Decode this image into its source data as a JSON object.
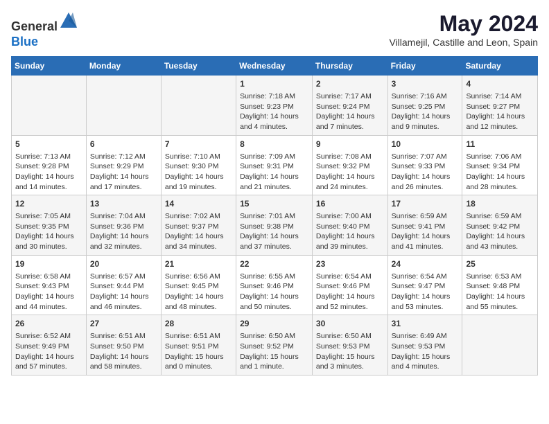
{
  "header": {
    "logo_line1": "General",
    "logo_line2": "Blue",
    "title": "May 2024",
    "subtitle": "Villamejil, Castille and Leon, Spain"
  },
  "weekdays": [
    "Sunday",
    "Monday",
    "Tuesday",
    "Wednesday",
    "Thursday",
    "Friday",
    "Saturday"
  ],
  "weeks": [
    [
      {
        "day": "",
        "info": ""
      },
      {
        "day": "",
        "info": ""
      },
      {
        "day": "",
        "info": ""
      },
      {
        "day": "1",
        "info": "Sunrise: 7:18 AM\nSunset: 9:23 PM\nDaylight: 14 hours and 4 minutes."
      },
      {
        "day": "2",
        "info": "Sunrise: 7:17 AM\nSunset: 9:24 PM\nDaylight: 14 hours and 7 minutes."
      },
      {
        "day": "3",
        "info": "Sunrise: 7:16 AM\nSunset: 9:25 PM\nDaylight: 14 hours and 9 minutes."
      },
      {
        "day": "4",
        "info": "Sunrise: 7:14 AM\nSunset: 9:27 PM\nDaylight: 14 hours and 12 minutes."
      }
    ],
    [
      {
        "day": "5",
        "info": "Sunrise: 7:13 AM\nSunset: 9:28 PM\nDaylight: 14 hours and 14 minutes."
      },
      {
        "day": "6",
        "info": "Sunrise: 7:12 AM\nSunset: 9:29 PM\nDaylight: 14 hours and 17 minutes."
      },
      {
        "day": "7",
        "info": "Sunrise: 7:10 AM\nSunset: 9:30 PM\nDaylight: 14 hours and 19 minutes."
      },
      {
        "day": "8",
        "info": "Sunrise: 7:09 AM\nSunset: 9:31 PM\nDaylight: 14 hours and 21 minutes."
      },
      {
        "day": "9",
        "info": "Sunrise: 7:08 AM\nSunset: 9:32 PM\nDaylight: 14 hours and 24 minutes."
      },
      {
        "day": "10",
        "info": "Sunrise: 7:07 AM\nSunset: 9:33 PM\nDaylight: 14 hours and 26 minutes."
      },
      {
        "day": "11",
        "info": "Sunrise: 7:06 AM\nSunset: 9:34 PM\nDaylight: 14 hours and 28 minutes."
      }
    ],
    [
      {
        "day": "12",
        "info": "Sunrise: 7:05 AM\nSunset: 9:35 PM\nDaylight: 14 hours and 30 minutes."
      },
      {
        "day": "13",
        "info": "Sunrise: 7:04 AM\nSunset: 9:36 PM\nDaylight: 14 hours and 32 minutes."
      },
      {
        "day": "14",
        "info": "Sunrise: 7:02 AM\nSunset: 9:37 PM\nDaylight: 14 hours and 34 minutes."
      },
      {
        "day": "15",
        "info": "Sunrise: 7:01 AM\nSunset: 9:38 PM\nDaylight: 14 hours and 37 minutes."
      },
      {
        "day": "16",
        "info": "Sunrise: 7:00 AM\nSunset: 9:40 PM\nDaylight: 14 hours and 39 minutes."
      },
      {
        "day": "17",
        "info": "Sunrise: 6:59 AM\nSunset: 9:41 PM\nDaylight: 14 hours and 41 minutes."
      },
      {
        "day": "18",
        "info": "Sunrise: 6:59 AM\nSunset: 9:42 PM\nDaylight: 14 hours and 43 minutes."
      }
    ],
    [
      {
        "day": "19",
        "info": "Sunrise: 6:58 AM\nSunset: 9:43 PM\nDaylight: 14 hours and 44 minutes."
      },
      {
        "day": "20",
        "info": "Sunrise: 6:57 AM\nSunset: 9:44 PM\nDaylight: 14 hours and 46 minutes."
      },
      {
        "day": "21",
        "info": "Sunrise: 6:56 AM\nSunset: 9:45 PM\nDaylight: 14 hours and 48 minutes."
      },
      {
        "day": "22",
        "info": "Sunrise: 6:55 AM\nSunset: 9:46 PM\nDaylight: 14 hours and 50 minutes."
      },
      {
        "day": "23",
        "info": "Sunrise: 6:54 AM\nSunset: 9:46 PM\nDaylight: 14 hours and 52 minutes."
      },
      {
        "day": "24",
        "info": "Sunrise: 6:54 AM\nSunset: 9:47 PM\nDaylight: 14 hours and 53 minutes."
      },
      {
        "day": "25",
        "info": "Sunrise: 6:53 AM\nSunset: 9:48 PM\nDaylight: 14 hours and 55 minutes."
      }
    ],
    [
      {
        "day": "26",
        "info": "Sunrise: 6:52 AM\nSunset: 9:49 PM\nDaylight: 14 hours and 57 minutes."
      },
      {
        "day": "27",
        "info": "Sunrise: 6:51 AM\nSunset: 9:50 PM\nDaylight: 14 hours and 58 minutes."
      },
      {
        "day": "28",
        "info": "Sunrise: 6:51 AM\nSunset: 9:51 PM\nDaylight: 15 hours and 0 minutes."
      },
      {
        "day": "29",
        "info": "Sunrise: 6:50 AM\nSunset: 9:52 PM\nDaylight: 15 hours and 1 minute."
      },
      {
        "day": "30",
        "info": "Sunrise: 6:50 AM\nSunset: 9:53 PM\nDaylight: 15 hours and 3 minutes."
      },
      {
        "day": "31",
        "info": "Sunrise: 6:49 AM\nSunset: 9:53 PM\nDaylight: 15 hours and 4 minutes."
      },
      {
        "day": "",
        "info": ""
      }
    ]
  ]
}
